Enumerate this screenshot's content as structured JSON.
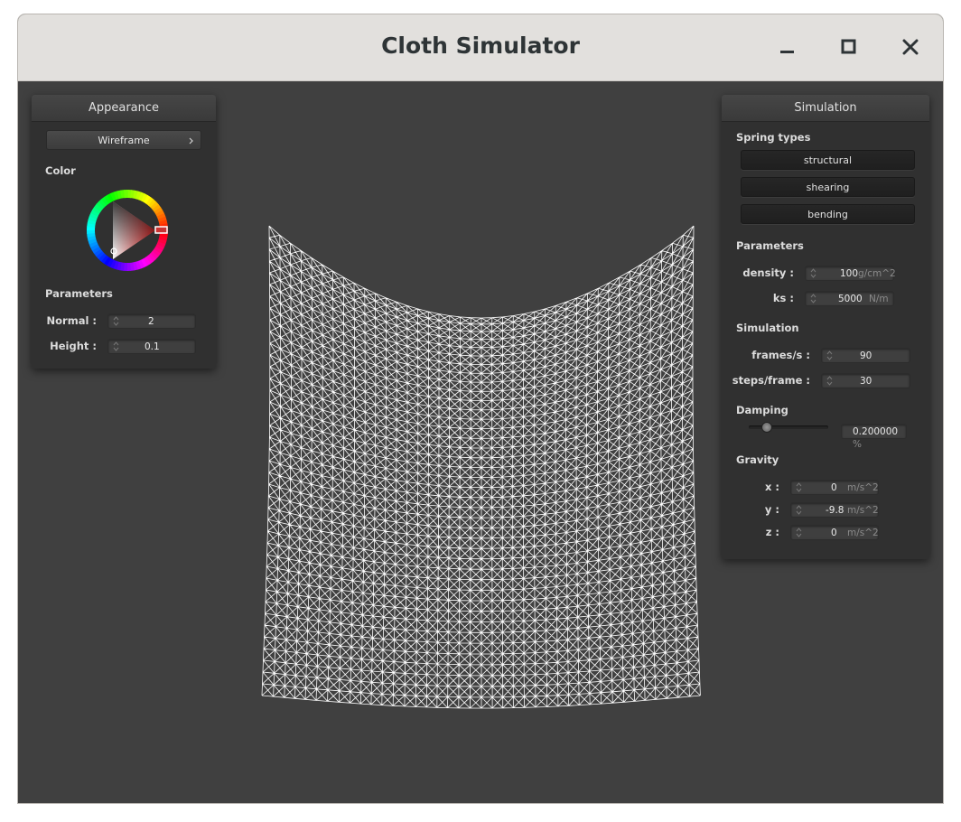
{
  "window": {
    "title": "Cloth Simulator"
  },
  "appearance": {
    "header": "Appearance",
    "shader_select": "Wireframe",
    "color_label": "Color",
    "params_label": "Parameters",
    "normal_label": "Normal :",
    "normal_value": "2",
    "height_label": "Height :",
    "height_value": "0.1",
    "selected_color": "#c83232"
  },
  "simulation": {
    "header": "Simulation",
    "spring_types_label": "Spring types",
    "spring_buttons": [
      "structural",
      "shearing",
      "bending"
    ],
    "params_label": "Parameters",
    "density_label": "density :",
    "density_value": "100",
    "density_unit": "g/cm^2",
    "ks_label": "ks :",
    "ks_value": "5000",
    "ks_unit": "N/m",
    "sim_label": "Simulation",
    "fps_label": "frames/s :",
    "fps_value": "90",
    "steps_label": "steps/frame :",
    "steps_value": "30",
    "damping_label": "Damping",
    "damping_value": "0.200000",
    "damping_unit": "%",
    "damping_slider_fraction": 0.2,
    "gravity_label": "Gravity",
    "gx_label": "x :",
    "gx_value": "0",
    "gy_label": "y :",
    "gy_value": "-9.8",
    "gz_label": "z :",
    "gz_value": "0",
    "gravity_unit": "m/s^2"
  },
  "icons": {
    "minimize": "minimize-icon",
    "maximize": "maximize-icon",
    "close": "close-icon",
    "chevron": "chevron-right-icon",
    "spinner": "spinner-arrows-icon"
  },
  "colors": {
    "background": "#404040",
    "mesh": "#ffffff",
    "panel": "#303030"
  }
}
